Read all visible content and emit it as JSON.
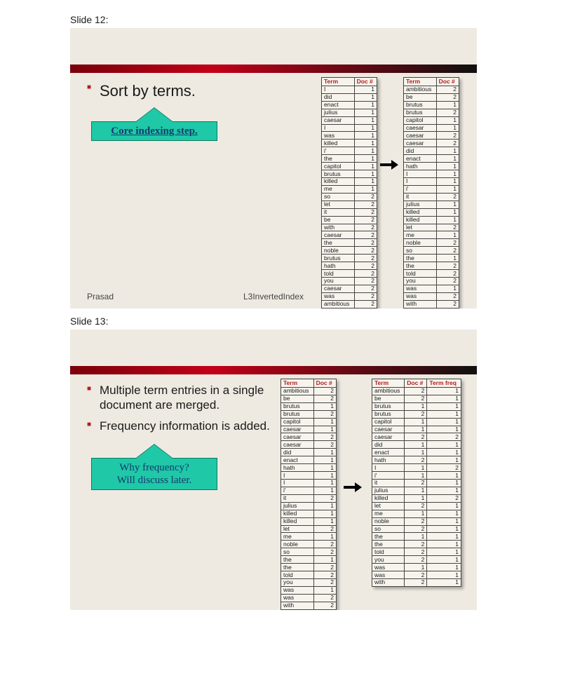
{
  "slide12_label": "Slide 12:",
  "slide13_label": "Slide 13:",
  "slide12": {
    "bullets": [
      "Sort by terms."
    ],
    "callout": "Core indexing step.",
    "footer_left": "Prasad",
    "footer_right": "L3InvertedIndex",
    "left_table": {
      "headers": [
        "Term",
        "Doc #"
      ],
      "rows": [
        [
          "I",
          "1"
        ],
        [
          "did",
          "1"
        ],
        [
          "enact",
          "1"
        ],
        [
          "julius",
          "1"
        ],
        [
          "caesar",
          "1"
        ],
        [
          "I",
          "1"
        ],
        [
          "was",
          "1"
        ],
        [
          "killed",
          "1"
        ],
        [
          "i'",
          "1"
        ],
        [
          "the",
          "1"
        ],
        [
          "capitol",
          "1"
        ],
        [
          "brutus",
          "1"
        ],
        [
          "killed",
          "1"
        ],
        [
          "me",
          "1"
        ],
        [
          "so",
          "2"
        ],
        [
          "let",
          "2"
        ],
        [
          "it",
          "2"
        ],
        [
          "be",
          "2"
        ],
        [
          "with",
          "2"
        ],
        [
          "caesar",
          "2"
        ],
        [
          "the",
          "2"
        ],
        [
          "noble",
          "2"
        ],
        [
          "brutus",
          "2"
        ],
        [
          "hath",
          "2"
        ],
        [
          "told",
          "2"
        ],
        [
          "you",
          "2"
        ],
        [
          "caesar",
          "2"
        ],
        [
          "was",
          "2"
        ],
        [
          "ambitious",
          "2"
        ]
      ]
    },
    "right_table": {
      "headers": [
        "Term",
        "Doc #"
      ],
      "rows": [
        [
          "ambitious",
          "2"
        ],
        [
          "be",
          "2"
        ],
        [
          "brutus",
          "1"
        ],
        [
          "brutus",
          "2"
        ],
        [
          "capitol",
          "1"
        ],
        [
          "caesar",
          "1"
        ],
        [
          "caesar",
          "2"
        ],
        [
          "caesar",
          "2"
        ],
        [
          "did",
          "1"
        ],
        [
          "enact",
          "1"
        ],
        [
          "hath",
          "1"
        ],
        [
          "I",
          "1"
        ],
        [
          "I",
          "1"
        ],
        [
          "i'",
          "1"
        ],
        [
          "it",
          "2"
        ],
        [
          "julius",
          "1"
        ],
        [
          "killed",
          "1"
        ],
        [
          "killed",
          "1"
        ],
        [
          "let",
          "2"
        ],
        [
          "me",
          "1"
        ],
        [
          "noble",
          "2"
        ],
        [
          "so",
          "2"
        ],
        [
          "the",
          "1"
        ],
        [
          "the",
          "2"
        ],
        [
          "told",
          "2"
        ],
        [
          "you",
          "2"
        ],
        [
          "was",
          "1"
        ],
        [
          "was",
          "2"
        ],
        [
          "with",
          "2"
        ]
      ]
    }
  },
  "slide13": {
    "bullets": [
      "Multiple term entries in a single document are merged.",
      "Frequency information is added."
    ],
    "callout": "Why frequency?\nWill discuss later.",
    "left_table": {
      "headers": [
        "Term",
        "Doc #"
      ],
      "rows": [
        [
          "ambitious",
          "2"
        ],
        [
          "be",
          "2"
        ],
        [
          "brutus",
          "1"
        ],
        [
          "brutus",
          "2"
        ],
        [
          "capitol",
          "1"
        ],
        [
          "caesar",
          "1"
        ],
        [
          "caesar",
          "2"
        ],
        [
          "caesar",
          "2"
        ],
        [
          "did",
          "1"
        ],
        [
          "enact",
          "1"
        ],
        [
          "hath",
          "1"
        ],
        [
          "I",
          "1"
        ],
        [
          "I",
          "1"
        ],
        [
          "i'",
          "1"
        ],
        [
          "it",
          "2"
        ],
        [
          "julius",
          "1"
        ],
        [
          "killed",
          "1"
        ],
        [
          "killed",
          "1"
        ],
        [
          "let",
          "2"
        ],
        [
          "me",
          "1"
        ],
        [
          "noble",
          "2"
        ],
        [
          "so",
          "2"
        ],
        [
          "the",
          "1"
        ],
        [
          "the",
          "2"
        ],
        [
          "told",
          "2"
        ],
        [
          "you",
          "2"
        ],
        [
          "was",
          "1"
        ],
        [
          "was",
          "2"
        ],
        [
          "with",
          "2"
        ]
      ]
    },
    "right_table": {
      "headers": [
        "Term",
        "Doc #",
        "Term freq"
      ],
      "rows": [
        [
          "ambitious",
          "2",
          "1"
        ],
        [
          "be",
          "2",
          "1"
        ],
        [
          "brutus",
          "1",
          "1"
        ],
        [
          "brutus",
          "2",
          "1"
        ],
        [
          "capitol",
          "1",
          "1"
        ],
        [
          "caesar",
          "1",
          "1"
        ],
        [
          "caesar",
          "2",
          "2"
        ],
        [
          "did",
          "1",
          "1"
        ],
        [
          "enact",
          "1",
          "1"
        ],
        [
          "hath",
          "2",
          "1"
        ],
        [
          "I",
          "1",
          "2"
        ],
        [
          "i'",
          "1",
          "1"
        ],
        [
          "it",
          "2",
          "1"
        ],
        [
          "julius",
          "1",
          "1"
        ],
        [
          "killed",
          "1",
          "2"
        ],
        [
          "let",
          "2",
          "1"
        ],
        [
          "me",
          "1",
          "1"
        ],
        [
          "noble",
          "2",
          "1"
        ],
        [
          "so",
          "2",
          "1"
        ],
        [
          "the",
          "1",
          "1"
        ],
        [
          "the",
          "2",
          "1"
        ],
        [
          "told",
          "2",
          "1"
        ],
        [
          "you",
          "2",
          "1"
        ],
        [
          "was",
          "1",
          "1"
        ],
        [
          "was",
          "2",
          "1"
        ],
        [
          "with",
          "2",
          "1"
        ]
      ]
    }
  }
}
